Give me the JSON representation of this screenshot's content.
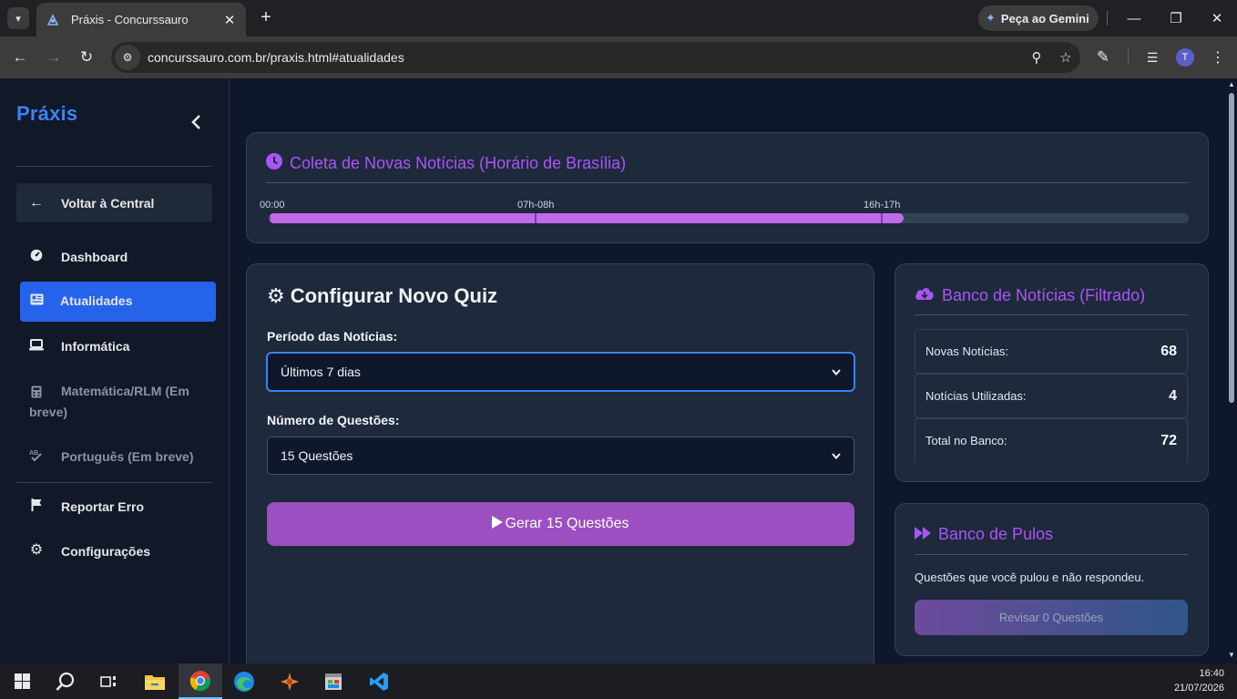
{
  "browser": {
    "tab_title": "Práxis - Concurssauro",
    "url": "concurssauro.com.br/praxis.html#atualidades",
    "gemini_label": "Peça ao Gemini",
    "profile_initial": "T"
  },
  "sidebar": {
    "brand": "Práxis",
    "back_label": "Voltar à Central",
    "items": [
      {
        "label": "Dashboard",
        "icon": "gauge-icon"
      },
      {
        "label": "Atualidades",
        "icon": "newspaper-icon"
      },
      {
        "label": "Informática",
        "icon": "laptop-icon"
      },
      {
        "label": "Matemática/RLM (Em breve)",
        "icon": "calculator-icon"
      },
      {
        "label": "Português (Em breve)",
        "icon": "spellcheck-icon"
      },
      {
        "label": "Reportar Erro",
        "icon": "flag-icon"
      },
      {
        "label": "Configurações",
        "icon": "gear-icon"
      }
    ]
  },
  "timeline": {
    "title": "Coleta de Novas Notícias (Horário de Brasília)",
    "labels": [
      "00:00",
      "07h-08h",
      "16h-17h"
    ],
    "progress": 0.69
  },
  "quiz": {
    "title": "Configurar Novo Quiz",
    "period_label": "Período das Notícias:",
    "period_value": "Últimos 7 dias",
    "count_label": "Número de Questões:",
    "count_value": "15 Questões",
    "generate_label": "Gerar 15 Questões"
  },
  "bank": {
    "title": "Banco de Notícias (Filtrado)",
    "rows": [
      {
        "label": "Novas Notícias:",
        "value": "68"
      },
      {
        "label": "Notícias Utilizadas:",
        "value": "4"
      },
      {
        "label": "Total no Banco:",
        "value": "72"
      }
    ]
  },
  "pulos": {
    "title": "Banco de Pulos",
    "description": "Questões que você pulou e não respondeu.",
    "review_label": "Revisar 0 Questões"
  },
  "taskbar": {
    "time": "16:40",
    "date": "21/07/2026"
  },
  "colors": {
    "accent_purple": "#a855f7",
    "active_blue": "#2563eb",
    "brand_blue": "#3b82f6"
  }
}
